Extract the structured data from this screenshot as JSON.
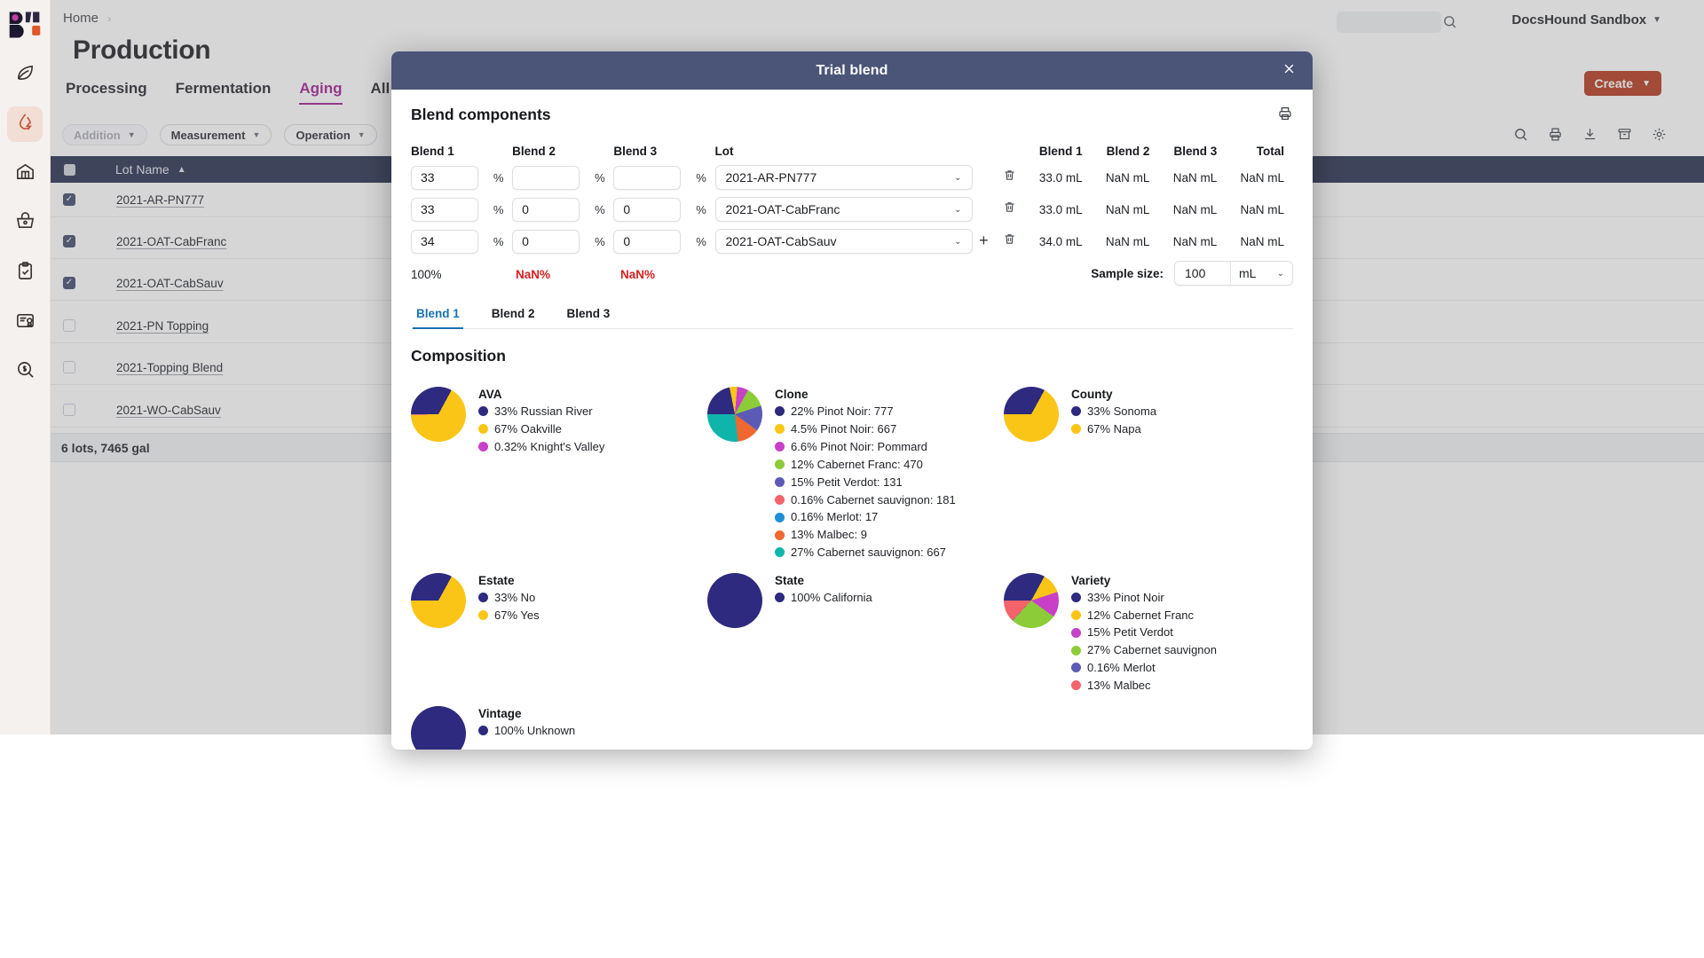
{
  "app": {
    "breadcrumb": "Home",
    "account": "DocsHound Sandbox",
    "page_title": "Production",
    "create_label": "Create",
    "tabs": [
      {
        "label": "Processing",
        "active": false
      },
      {
        "label": "Fermentation",
        "active": false
      },
      {
        "label": "Aging",
        "active": true
      },
      {
        "label": "All Lots",
        "active": false
      }
    ],
    "filters": [
      {
        "label": "Addition",
        "muted": true
      },
      {
        "label": "Measurement",
        "muted": false
      },
      {
        "label": "Operation",
        "muted": false
      }
    ],
    "table": {
      "header": "Lot Name",
      "sort_arrow": "▲",
      "rows": [
        {
          "name": "2021-AR-PN777",
          "checked": true
        },
        {
          "name": "2021-OAT-CabFranc",
          "checked": true
        },
        {
          "name": "2021-OAT-CabSauv",
          "checked": true
        },
        {
          "name": "2021-PN Topping",
          "checked": false
        },
        {
          "name": "2021-Topping Blend",
          "checked": false
        },
        {
          "name": "2021-WO-CabSauv",
          "checked": false
        }
      ],
      "summary": "6 lots, 7465 gal"
    }
  },
  "modal": {
    "title": "Trial blend",
    "blend_components": {
      "heading": "Blend components",
      "column_headers": [
        "Blend 1",
        "Blend 2",
        "Blend 3",
        "Lot"
      ],
      "result_headers": [
        "Blend 1",
        "Blend 2",
        "Blend 3",
        "Total"
      ],
      "percent_symbol": "%",
      "rows": [
        {
          "blend1": "33",
          "blend2": "",
          "blend3": "",
          "lot": "2021-AR-PN777",
          "values": [
            "33.0 mL",
            "NaN mL",
            "NaN mL",
            "NaN mL"
          ],
          "has_add": false
        },
        {
          "blend1": "33",
          "blend2": "0",
          "blend3": "0",
          "lot": "2021-OAT-CabFranc",
          "values": [
            "33.0 mL",
            "NaN mL",
            "NaN mL",
            "NaN mL"
          ],
          "has_add": false
        },
        {
          "blend1": "34",
          "blend2": "0",
          "blend3": "0",
          "lot": "2021-OAT-CabSauv",
          "values": [
            "34.0 mL",
            "NaN mL",
            "NaN mL",
            "NaN mL"
          ],
          "has_add": true
        }
      ],
      "totals": [
        {
          "text": "100%",
          "error": false
        },
        {
          "text": "NaN%",
          "error": true
        },
        {
          "text": "NaN%",
          "error": true
        }
      ],
      "sample_size": {
        "label": "Sample size:",
        "value": "100",
        "unit": "mL"
      }
    },
    "blend_tabs": [
      {
        "label": "Blend 1",
        "active": true
      },
      {
        "label": "Blend 2",
        "active": false
      },
      {
        "label": "Blend 3",
        "active": false
      }
    ],
    "composition": {
      "heading": "Composition",
      "groups": [
        {
          "name": "AVA",
          "items": [
            {
              "label": "33% Russian River",
              "color": "#2e2a7f",
              "value": 33
            },
            {
              "label": "67% Oakville",
              "color": "#fac516",
              "value": 67
            },
            {
              "label": "0.32% Knight's Valley",
              "color": "#c740c7",
              "value": 0.32
            }
          ]
        },
        {
          "name": "Clone",
          "items": [
            {
              "label": "22% Pinot Noir: 777",
              "color": "#2e2a7f",
              "value": 22
            },
            {
              "label": "4.5% Pinot Noir: 667",
              "color": "#fac516",
              "value": 4.5
            },
            {
              "label": "6.6% Pinot Noir: Pommard",
              "color": "#c740c7",
              "value": 6.6
            },
            {
              "label": "12% Cabernet Franc: 470",
              "color": "#8ccc38",
              "value": 12
            },
            {
              "label": "15% Petit Verdot: 131",
              "color": "#5b5bb5",
              "value": 15
            },
            {
              "label": "0.16% Cabernet sauvignon: 181",
              "color": "#f4636b",
              "value": 0.16
            },
            {
              "label": "0.16% Merlot: 17",
              "color": "#1f8fd6",
              "value": 0.16
            },
            {
              "label": "13% Malbec: 9",
              "color": "#f0672f",
              "value": 13
            },
            {
              "label": "27% Cabernet sauvignon: 667",
              "color": "#0fb5ab",
              "value": 27
            }
          ]
        },
        {
          "name": "County",
          "items": [
            {
              "label": "33% Sonoma",
              "color": "#2e2a7f",
              "value": 33
            },
            {
              "label": "67% Napa",
              "color": "#fac516",
              "value": 67
            }
          ]
        },
        {
          "name": "Estate",
          "items": [
            {
              "label": "33% No",
              "color": "#2e2a7f",
              "value": 33
            },
            {
              "label": "67% Yes",
              "color": "#fac516",
              "value": 67
            }
          ]
        },
        {
          "name": "State",
          "items": [
            {
              "label": "100% California",
              "color": "#2e2a7f",
              "value": 100
            }
          ]
        },
        {
          "name": "Variety",
          "items": [
            {
              "label": "33% Pinot Noir",
              "color": "#2e2a7f",
              "value": 33
            },
            {
              "label": "12% Cabernet Franc",
              "color": "#fac516",
              "value": 12
            },
            {
              "label": "15% Petit Verdot",
              "color": "#c740c7",
              "value": 15
            },
            {
              "label": "27% Cabernet sauvignon",
              "color": "#8ccc38",
              "value": 27
            },
            {
              "label": "0.16% Merlot",
              "color": "#5b5bb5",
              "value": 0.16
            },
            {
              "label": "13% Malbec",
              "color": "#f4636b",
              "value": 13
            }
          ]
        },
        {
          "name": "Vintage",
          "items": [
            {
              "label": "100% Unknown",
              "color": "#2e2a7f",
              "value": 100
            }
          ]
        }
      ]
    }
  },
  "colors": {
    "modal_header": "#4a5578",
    "accent_tab": "#a01f8f",
    "accent_blend_tab": "#1773b0",
    "create_button": "#b3391c",
    "table_header": "#262f4c",
    "error": "#d41f1f"
  },
  "icons": {
    "sidebar": [
      "leaf-icon",
      "droplet-bolt-icon",
      "warehouse-icon",
      "basket-icon",
      "clipboard-check-icon",
      "certificate-icon",
      "money-search-icon"
    ],
    "toolbar": [
      "search-icon",
      "print-icon",
      "download-icon",
      "archive-icon",
      "gear-icon"
    ]
  }
}
